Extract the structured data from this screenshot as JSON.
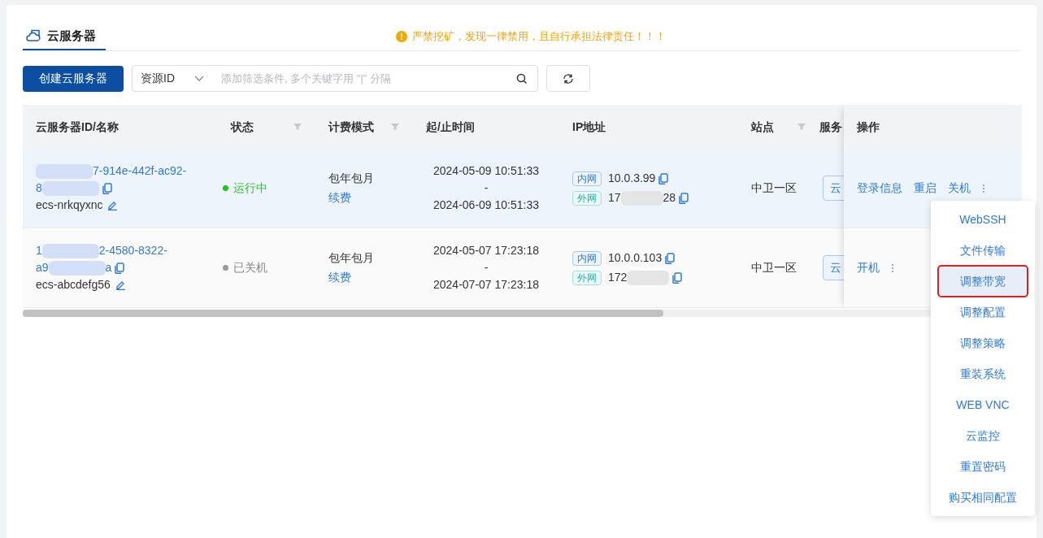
{
  "tab": {
    "label": "云服务器",
    "selected": true
  },
  "notice": "严禁挖矿，发现一律禁用，且自行承担法律责任！！！",
  "create_button": "创建云服务器",
  "filter": {
    "field": "资源ID",
    "placeholder": "添加筛选条件, 多个关键字用 \"|\" 分隔"
  },
  "table": {
    "columns": [
      {
        "label": "云服务器ID/名称",
        "filter": false
      },
      {
        "label": "状态",
        "filter": true
      },
      {
        "label": "计费模式",
        "filter": true
      },
      {
        "label": "起/止时间",
        "filter": false
      },
      {
        "label": "IP地址",
        "filter": false
      },
      {
        "label": "站点",
        "filter": true
      },
      {
        "label": "服务"
      }
    ],
    "action_column": "操作",
    "rows": [
      {
        "id_lines": [
          [
            {
              "kind": "blur"
            },
            {
              "kind": "text",
              "text": "7-914e-442f-ac92-"
            }
          ],
          [
            {
              "kind": "text",
              "text": "8"
            },
            {
              "kind": "blur"
            }
          ]
        ],
        "name": "ecs-nrkqyxnc",
        "status": {
          "text": "运行中",
          "running": true
        },
        "billing": "包年包月",
        "renew": "续费",
        "start": "2024-05-09 10:51:33",
        "sep": "-",
        "end": "2024-06-09 10:51:33",
        "ips": [
          {
            "tag": "内网",
            "kind": "internal",
            "parts": [
              {
                "kind": "text",
                "text": "10.0.3.99"
              }
            ]
          },
          {
            "tag": "外网",
            "kind": "external",
            "parts": [
              {
                "kind": "text",
                "text": "17"
              },
              {
                "kind": "blur"
              },
              {
                "kind": "text",
                "text": "28"
              }
            ]
          }
        ],
        "site": "中卫一区",
        "service": "云",
        "actions": [
          "登录信息",
          "重启",
          "关机"
        ],
        "hovered": true
      },
      {
        "id_lines": [
          [
            {
              "kind": "text",
              "text": "1"
            },
            {
              "kind": "blur"
            },
            {
              "kind": "text",
              "text": "2-4580-8322-"
            }
          ],
          [
            {
              "kind": "text",
              "text": "a9"
            },
            {
              "kind": "blur"
            },
            {
              "kind": "text",
              "text": "a"
            }
          ]
        ],
        "name": "ecs-abcdefg56",
        "status": {
          "text": "已关机",
          "running": false
        },
        "billing": "包年包月",
        "renew": "续费",
        "start": "2024-05-07 17:23:18",
        "sep": "-",
        "end": "2024-07-07 17:23:18",
        "ips": [
          {
            "tag": "内网",
            "kind": "internal",
            "parts": [
              {
                "kind": "text",
                "text": "10.0.0.103"
              }
            ]
          },
          {
            "tag": "外网",
            "kind": "external",
            "parts": [
              {
                "kind": "text",
                "text": "172"
              },
              {
                "kind": "blur"
              }
            ]
          }
        ],
        "site": "中卫一区",
        "service": "云",
        "actions": [
          "开机"
        ],
        "hovered": false
      }
    ]
  },
  "menu": [
    {
      "label": "WebSSH",
      "selected": false
    },
    {
      "label": "文件传输",
      "selected": false
    },
    {
      "label": "调整带宽",
      "selected": true
    },
    {
      "label": "调整配置",
      "selected": false
    },
    {
      "label": "调整策略",
      "selected": false
    },
    {
      "label": "重装系统",
      "selected": false
    },
    {
      "label": "WEB VNC",
      "selected": false
    },
    {
      "label": "云监控",
      "selected": false
    },
    {
      "label": "重置密码",
      "selected": false
    },
    {
      "label": "购买相同配置",
      "selected": false
    }
  ]
}
